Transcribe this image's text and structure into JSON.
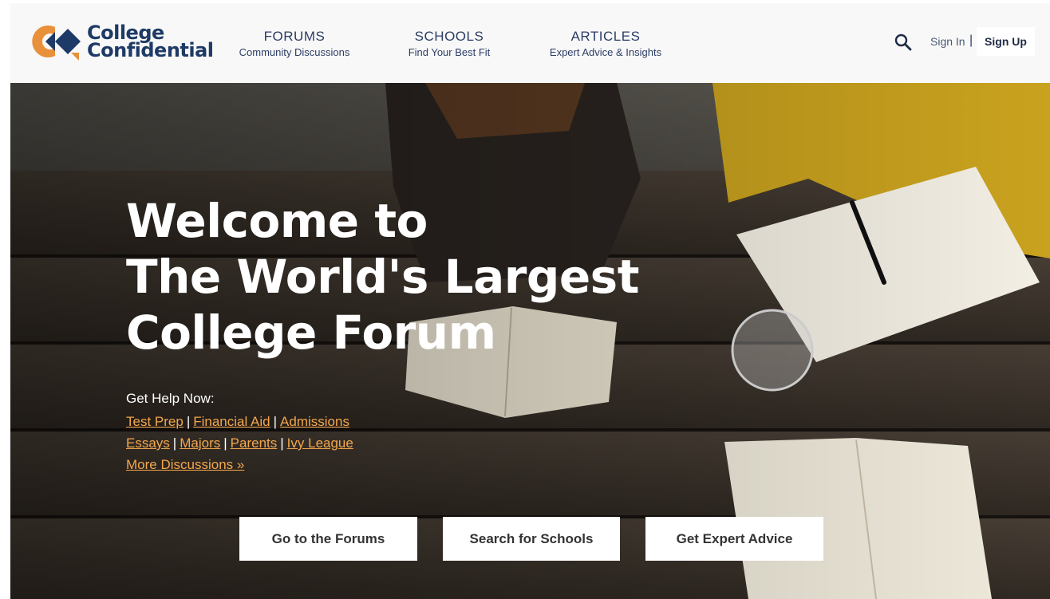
{
  "brand": {
    "line1": "College",
    "line2": "Confidential",
    "colors": {
      "orange": "#e8913a",
      "navy": "#1e3a66"
    }
  },
  "nav": [
    {
      "title": "FORUMS",
      "subtitle": "Community Discussions"
    },
    {
      "title": "SCHOOLS",
      "subtitle": "Find Your Best Fit"
    },
    {
      "title": "ARTICLES",
      "subtitle": "Expert Advice & Insights"
    }
  ],
  "header": {
    "search_icon": "search-icon",
    "sign_in": "Sign In",
    "pipe": "|",
    "sign_up": "Sign Up"
  },
  "hero": {
    "headline": [
      "Welcome to",
      "The World's Largest",
      "College Forum"
    ],
    "help_label": "Get Help Now:",
    "links": {
      "test_prep": "Test Prep",
      "financial_aid": "Financial Aid",
      "admissions": "Admissions",
      "essays": "Essays",
      "majors": "Majors",
      "parents": "Parents",
      "ivy_league": "Ivy League",
      "more": "More Discussions »"
    },
    "link_separator": "|",
    "buttons": {
      "forums": "Go to the Forums",
      "schools": "Search for Schools",
      "advice": "Get Expert Advice"
    }
  }
}
